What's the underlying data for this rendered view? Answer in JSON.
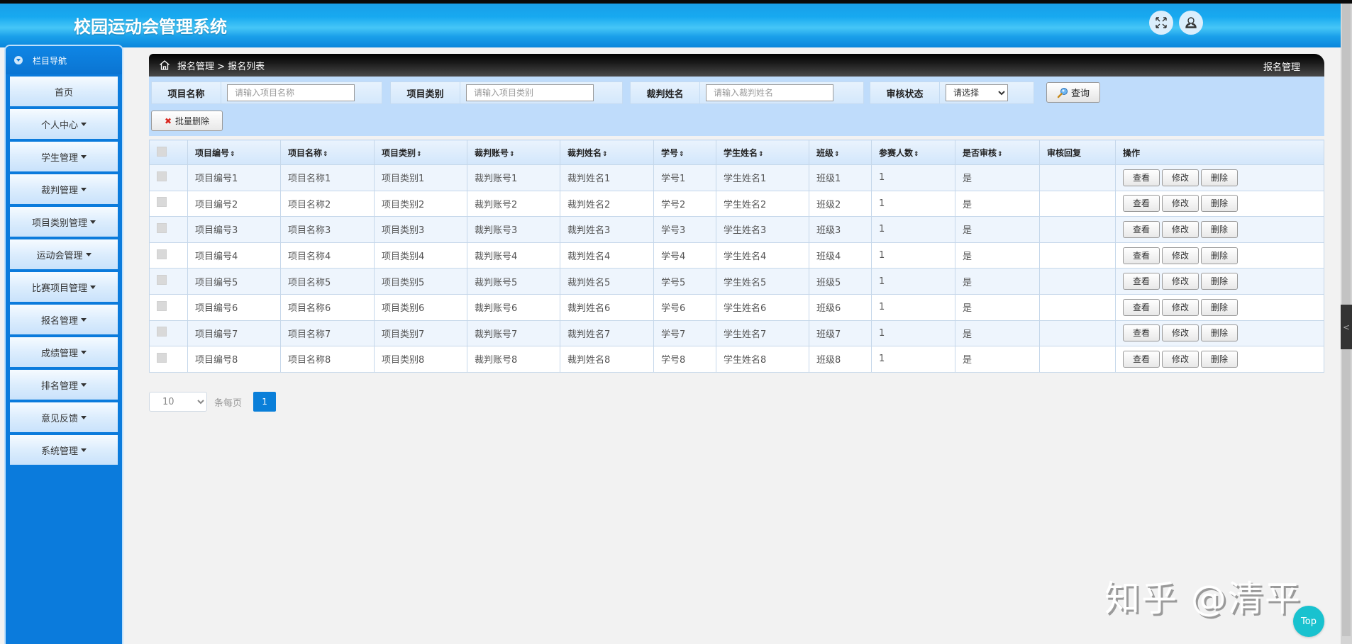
{
  "header": {
    "title": "校园运动会管理系统",
    "fullscreen_icon": "expand-arrows-icon",
    "user_icon": "user-icon"
  },
  "sidebar": {
    "heading": "栏目导航",
    "items": [
      {
        "label": "首页",
        "has_dropdown": false
      },
      {
        "label": "个人中心",
        "has_dropdown": true
      },
      {
        "label": "学生管理",
        "has_dropdown": true
      },
      {
        "label": "裁判管理",
        "has_dropdown": true
      },
      {
        "label": "项目类别管理",
        "has_dropdown": true
      },
      {
        "label": "运动会管理",
        "has_dropdown": true
      },
      {
        "label": "比赛项目管理",
        "has_dropdown": true
      },
      {
        "label": "报名管理",
        "has_dropdown": true
      },
      {
        "label": "成绩管理",
        "has_dropdown": true
      },
      {
        "label": "排名管理",
        "has_dropdown": true
      },
      {
        "label": "意见反馈",
        "has_dropdown": true
      },
      {
        "label": "系统管理",
        "has_dropdown": true
      }
    ]
  },
  "breadcrumb": {
    "path": "报名管理 > 报名列表",
    "section": "报名管理"
  },
  "search": {
    "fields": [
      {
        "label": "项目名称",
        "placeholder": "请输入项目名称",
        "value": ""
      },
      {
        "label": "项目类别",
        "placeholder": "请输入项目类别",
        "value": ""
      },
      {
        "label": "裁判姓名",
        "placeholder": "请输入裁判姓名",
        "value": ""
      }
    ],
    "status": {
      "label": "审核状态",
      "selected": "请选择"
    },
    "query_label": "查询",
    "batch_delete_label": "批量删除"
  },
  "table": {
    "columns": [
      "项目编号",
      "项目名称",
      "项目类别",
      "裁判账号",
      "裁判姓名",
      "学号",
      "学生姓名",
      "班级",
      "参赛人数",
      "是否审核",
      "审核回复",
      "操作"
    ],
    "sortable": [
      true,
      true,
      true,
      true,
      true,
      true,
      true,
      true,
      true,
      true,
      false,
      false
    ],
    "sort_glyph": "⇕",
    "actions": {
      "view": "查看",
      "edit": "修改",
      "delete": "删除"
    },
    "rows": [
      [
        "项目编号1",
        "项目名称1",
        "项目类别1",
        "裁判账号1",
        "裁判姓名1",
        "学号1",
        "学生姓名1",
        "班级1",
        "1",
        "是",
        ""
      ],
      [
        "项目编号2",
        "项目名称2",
        "项目类别2",
        "裁判账号2",
        "裁判姓名2",
        "学号2",
        "学生姓名2",
        "班级2",
        "1",
        "是",
        ""
      ],
      [
        "项目编号3",
        "项目名称3",
        "项目类别3",
        "裁判账号3",
        "裁判姓名3",
        "学号3",
        "学生姓名3",
        "班级3",
        "1",
        "是",
        ""
      ],
      [
        "项目编号4",
        "项目名称4",
        "项目类别4",
        "裁判账号4",
        "裁判姓名4",
        "学号4",
        "学生姓名4",
        "班级4",
        "1",
        "是",
        ""
      ],
      [
        "项目编号5",
        "项目名称5",
        "项目类别5",
        "裁判账号5",
        "裁判姓名5",
        "学号5",
        "学生姓名5",
        "班级5",
        "1",
        "是",
        ""
      ],
      [
        "项目编号6",
        "项目名称6",
        "项目类别6",
        "裁判账号6",
        "裁判姓名6",
        "学号6",
        "学生姓名6",
        "班级6",
        "1",
        "是",
        ""
      ],
      [
        "项目编号7",
        "项目名称7",
        "项目类别7",
        "裁判账号7",
        "裁判姓名7",
        "学号7",
        "学生姓名7",
        "班级7",
        "1",
        "是",
        ""
      ],
      [
        "项目编号8",
        "项目名称8",
        "项目类别8",
        "裁判账号8",
        "裁判姓名8",
        "学号8",
        "学生姓名8",
        "班级8",
        "1",
        "是",
        ""
      ]
    ]
  },
  "pagination": {
    "page_size": "10",
    "per_page_label": "条每页",
    "current_page": "1"
  },
  "side_tab_glyph": "<",
  "watermark": "知乎 @清平",
  "top_button_label": "Top",
  "colors": {
    "header_blue": "#17a9f0",
    "sidebar_blue": "#0b7bdc",
    "search_bg": "#bfdcfb",
    "page_button": "#0a7fd9",
    "top_button": "#19c2cf",
    "delete_x": "#d9251d"
  }
}
